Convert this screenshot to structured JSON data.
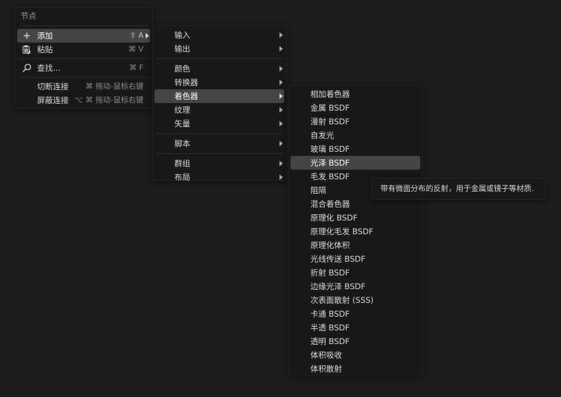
{
  "node_menu": {
    "title": "节点",
    "add": {
      "label": "添加",
      "shortcut": "⇧ A",
      "icon": "plus-icon"
    },
    "paste": {
      "label": "粘贴",
      "shortcut": "⌘ V",
      "icon": "paste-icon"
    },
    "find": {
      "label": "查找...",
      "shortcut": "⌘ F",
      "icon": "magnifier-icon"
    },
    "cut_links": {
      "label": "切断连接",
      "shortcut": "⌘ 拖动-鼠标右键"
    },
    "mute_links": {
      "label": "屏蔽连接",
      "shortcut": "⌥ ⌘ 拖动-鼠标右键"
    }
  },
  "add_menu": {
    "items": [
      "输入",
      "输出",
      "颜色",
      "转换器",
      "着色器",
      "纹理",
      "矢量",
      "脚本",
      "群组",
      "布局"
    ],
    "active_item": "着色器"
  },
  "shader_menu": {
    "items": [
      "相加着色器",
      "金属 BSDF",
      "漫射 BSDF",
      "自发光",
      "玻璃 BSDF",
      "光泽 BSDF",
      "毛发 BSDF",
      "阻隔",
      "混合着色器",
      "原理化 BSDF",
      "原理化毛发 BSDF",
      "原理化体积",
      "光线传送 BSDF",
      "折射 BSDF",
      "边缘光泽 BSDF",
      "次表面散射 (SSS)",
      "卡通 BSDF",
      "半透 BSDF",
      "透明 BSDF",
      "体积吸收",
      "体积散射"
    ],
    "highlighted_item": "光泽 BSDF"
  },
  "tooltip": {
    "text": "带有微面分布的反射，用于金属或镜子等材质."
  }
}
